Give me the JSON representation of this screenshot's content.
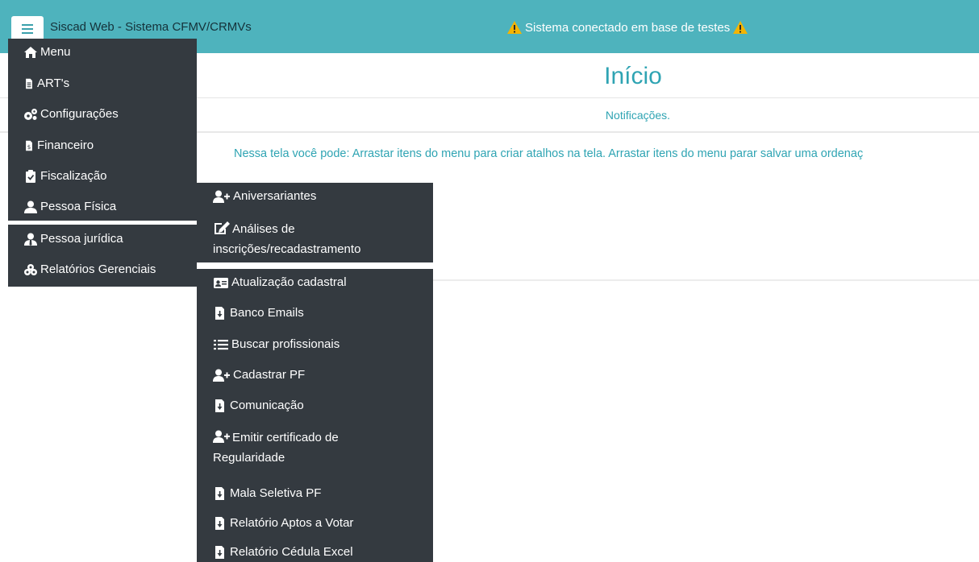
{
  "header": {
    "app_title": "Siscad Web - Sistema CFMV/CRMVs",
    "test_banner": "Sistema conectado em base de testes"
  },
  "main": {
    "title": "Início",
    "notifications": "Notificações.",
    "hint": "Nessa tela você pode: Arrastar itens do menu para criar atalhos na tela. Arrastar itens do menu parar salvar uma ordenaç"
  },
  "sidebar": {
    "items": [
      {
        "label": "Menu",
        "icon": "home-icon"
      },
      {
        "label": "ART's",
        "icon": "file-icon"
      },
      {
        "label": "Configurações",
        "icon": "gears-icon"
      },
      {
        "label": "Financeiro",
        "icon": "file-invoice-icon"
      },
      {
        "label": "Fiscalização",
        "icon": "clipboard-check-icon"
      },
      {
        "label": "Pessoa Física",
        "icon": "user-icon"
      },
      {
        "label": "Pessoa jurídica",
        "icon": "user-tie-icon"
      },
      {
        "label": "Relatórios Gerenciais",
        "icon": "cubes-icon"
      }
    ]
  },
  "submenu": {
    "items": [
      {
        "label": "Aniversariantes",
        "icon": "user-plus-icon"
      },
      {
        "label": "Análises de inscrições/recadastramento",
        "line1": "Análises de",
        "line2": "inscrições/recadastramento",
        "icon": "edit-icon"
      },
      {
        "label": "Atualização cadastral",
        "icon": "id-card-icon"
      },
      {
        "label": "Banco Emails",
        "icon": "file-download-icon"
      },
      {
        "label": "Buscar profissionais",
        "icon": "list-icon"
      },
      {
        "label": "Cadastrar PF",
        "icon": "user-plus-icon"
      },
      {
        "label": "Comunicação",
        "icon": "file-download-icon"
      },
      {
        "label": "Emitir certificado de Regularidade",
        "line1": "Emitir certificado de",
        "line2": "Regularidade",
        "icon": "user-plus-icon"
      },
      {
        "label": "Mala Seletiva PF",
        "icon": "file-download-icon"
      },
      {
        "label": "Relatório Aptos a Votar",
        "icon": "file-download-icon"
      },
      {
        "label": "Relatório Cédula Excel",
        "icon": "file-download-icon"
      }
    ]
  },
  "colors": {
    "header_bg": "#4eb3bd",
    "menu_bg": "#343a40",
    "accent_text": "#2fa4b3",
    "warning": "#f5b400"
  }
}
